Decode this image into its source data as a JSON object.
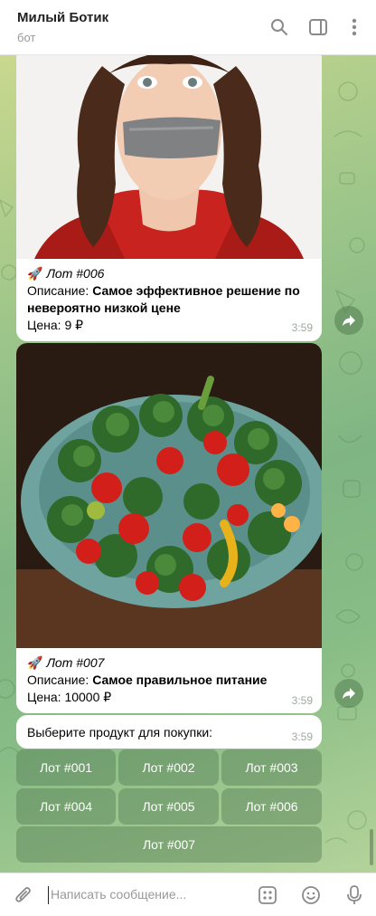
{
  "header": {
    "title": "Милый Ботик",
    "subtitle": "бот"
  },
  "messages": [
    {
      "emoji": "🚀",
      "lot_label": "Лот #006",
      "desc_prefix": "Описание: ",
      "desc_text": "Самое эффективное решение по невероятно низкой цене",
      "price": "Цена: 9 ₽",
      "time": "3:59"
    },
    {
      "emoji": "🚀",
      "lot_label": "Лот #007",
      "desc_prefix": "Описание: ",
      "desc_text": "Самое правильное питание",
      "price": "Цена: 10000 ₽",
      "time": "3:59"
    }
  ],
  "prompt": {
    "text": "Выберите продукт для покупки:",
    "time": "3:59"
  },
  "keyboard": [
    "Лот #001",
    "Лот #002",
    "Лот #003",
    "Лот #004",
    "Лот #005",
    "Лот #006",
    "Лот #007"
  ],
  "composer": {
    "placeholder": "Написать сообщение..."
  },
  "icons": [
    "search-icon",
    "sidebar-toggle-icon",
    "more-vert-icon",
    "share-icon",
    "attach-icon",
    "bot-commands-icon",
    "emoji-icon",
    "microphone-icon"
  ]
}
